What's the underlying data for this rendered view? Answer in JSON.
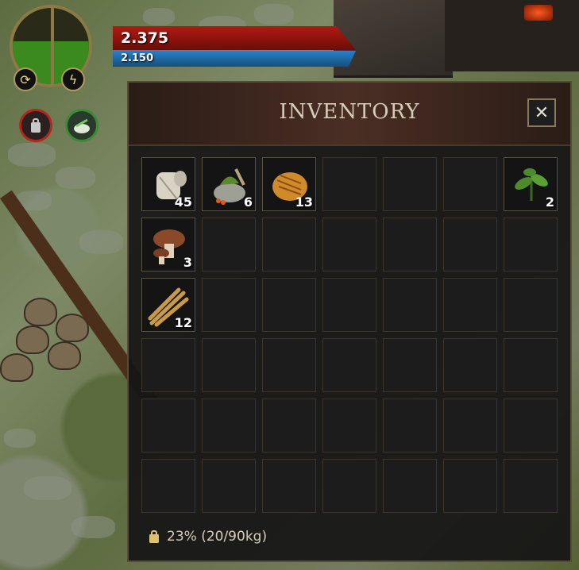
{
  "hud": {
    "health_value": "2.375",
    "mana_value": "2.150",
    "orb_left_icon": "swap-icon",
    "orb_right_icon": "lightning-icon",
    "status_icons": [
      "weight-icon",
      "herb-buff-icon"
    ]
  },
  "inventory": {
    "title": "INVENTORY",
    "close_label": "✕",
    "weight_text": "23% (20/90kg)",
    "weight_ratio": 0.23,
    "items": [
      {
        "slot": 0,
        "name": "cloth-roll",
        "icon": "cloth-icon",
        "quantity": "45"
      },
      {
        "slot": 1,
        "name": "herb-mortar",
        "icon": "mortar-icon",
        "quantity": "6"
      },
      {
        "slot": 2,
        "name": "bread",
        "icon": "bread-icon",
        "quantity": "13"
      },
      {
        "slot": 6,
        "name": "leaf-plant",
        "icon": "leaf-icon",
        "quantity": "2"
      },
      {
        "slot": 7,
        "name": "mushroom",
        "icon": "mushroom-icon",
        "quantity": "3"
      },
      {
        "slot": 14,
        "name": "wheat",
        "icon": "wheat-icon",
        "quantity": "12"
      }
    ]
  },
  "colors": {
    "health": "#b01a12",
    "mana": "#2a80c8",
    "orb_fill": "#3b8a1f",
    "panel_border": "#5a4c34"
  }
}
